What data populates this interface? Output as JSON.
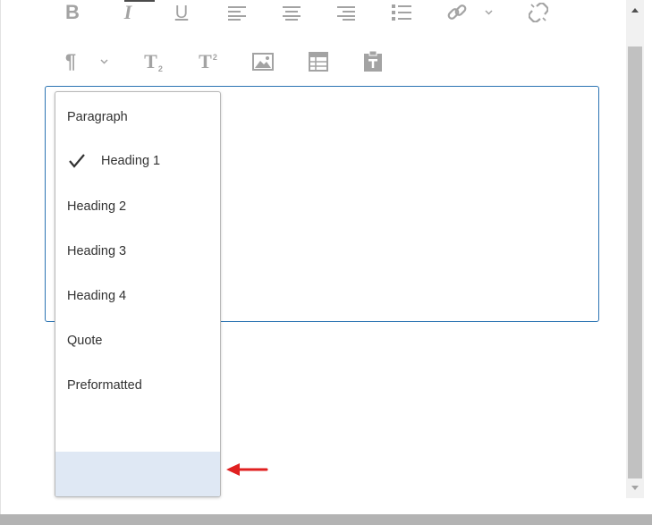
{
  "toolbar": {
    "row1": [
      {
        "name": "bold-icon",
        "glyph": "B"
      },
      {
        "name": "italic-icon",
        "glyph": "I"
      },
      {
        "name": "underline-icon",
        "glyph": "U"
      },
      {
        "name": "align-left-icon"
      },
      {
        "name": "align-center-icon"
      },
      {
        "name": "align-right-icon"
      },
      {
        "name": "bulleted-list-icon"
      },
      {
        "name": "link-icon"
      },
      {
        "name": "chevron-down-icon"
      },
      {
        "name": "unlink-icon"
      }
    ],
    "row2": [
      {
        "name": "paragraph-format-icon",
        "glyph": "¶"
      },
      {
        "name": "chevron-down-icon"
      },
      {
        "name": "subscript-icon",
        "glyph": "T",
        "sub": "2"
      },
      {
        "name": "superscript-icon",
        "glyph": "T",
        "sup": "2"
      },
      {
        "name": "image-icon"
      },
      {
        "name": "table-icon"
      },
      {
        "name": "paste-as-text-icon"
      }
    ]
  },
  "format_menu": {
    "items": [
      {
        "label": "Paragraph",
        "checked": false
      },
      {
        "label": "Heading 1",
        "checked": true
      },
      {
        "label": "Heading 2",
        "checked": false
      },
      {
        "label": "Heading 3",
        "checked": false
      },
      {
        "label": "Heading 4",
        "checked": false
      },
      {
        "label": "Quote",
        "checked": false
      },
      {
        "label": "Preformatted",
        "checked": false
      }
    ],
    "highlight_color": "#dfe8f4"
  },
  "colors": {
    "icon": "#a3a3a3",
    "editor_border": "#2c74b3",
    "annotation_arrow": "#e02020"
  }
}
